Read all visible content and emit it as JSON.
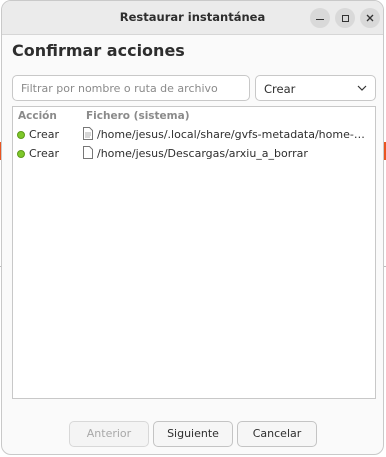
{
  "window": {
    "title": "Restaurar instantánea"
  },
  "page": {
    "heading": "Confirmar acciones"
  },
  "filter": {
    "placeholder": "Filtrar por nombre o ruta de archivo"
  },
  "action_filter": {
    "selected": "Crear"
  },
  "table": {
    "columns": [
      "Acción",
      "Fichero (sistema)"
    ],
    "rows": [
      {
        "action": "Crear",
        "path": "/home/jesus/.local/share/gvfs-metadata/home-…",
        "icon": "text-file-icon"
      },
      {
        "action": "Crear",
        "path": "/home/jesus/Descargas/arxiu_a_borrar",
        "icon": "blank-file-icon"
      }
    ]
  },
  "buttons": {
    "back": "Anterior",
    "next": "Siguiente",
    "cancel": "Cancelar"
  },
  "colors": {
    "action_create": "#7ec82a",
    "background_accent": "#e95420"
  }
}
